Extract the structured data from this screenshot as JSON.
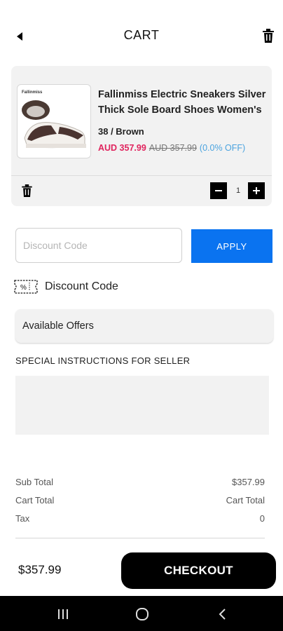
{
  "header": {
    "title": "CART"
  },
  "cart_item": {
    "name": "Fallinmiss Electric Sneakers Silver Thick Sole Board Shoes Women's",
    "thumbnail_brand": "Fallinmiss",
    "variant": "38 / Brown",
    "price": "AUD 357.99",
    "original_price": "AUD 357.99",
    "discount": "(0.0% OFF)",
    "quantity": "1"
  },
  "discount": {
    "placeholder": "Discount Code",
    "apply_label": "APPLY",
    "coupon_label": "Discount Code"
  },
  "offers": {
    "label": "Available Offers"
  },
  "instructions": {
    "label": "SPECIAL INSTRUCTIONS FOR SELLER"
  },
  "summary": {
    "rows": [
      {
        "label": "Sub Total",
        "value": "$357.99"
      },
      {
        "label": "Cart Total",
        "value": "Cart Total"
      },
      {
        "label": "Tax",
        "value": "0"
      }
    ]
  },
  "footer": {
    "total": "$357.99",
    "checkout_label": "CHECKOUT"
  },
  "icons": {
    "back": "back-arrow-icon",
    "delete": "trash-icon",
    "minus": "minus-icon",
    "plus": "plus-icon",
    "coupon": "coupon-icon"
  }
}
